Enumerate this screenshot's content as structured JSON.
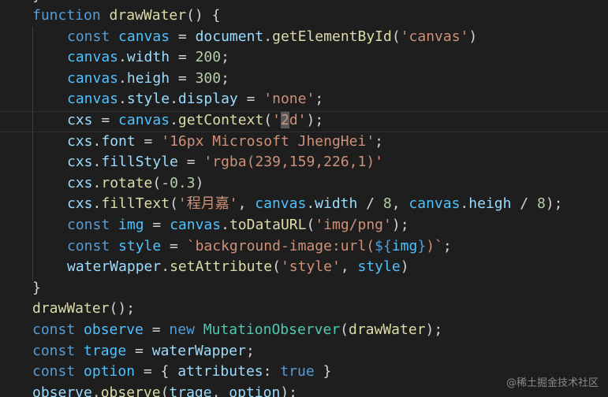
{
  "editor": {
    "colors": {
      "background": "#1e1e1e",
      "keyword": "#569cd6",
      "function": "#dcdcaa",
      "variable": "#9cdcfe",
      "constant": "#4fc1ff",
      "string": "#ce9178",
      "number": "#b5cea8",
      "class": "#4ec9b0"
    },
    "top_brace": "}",
    "lines": [
      {
        "indent": 0,
        "tokens": [
          [
            "kw",
            "function"
          ],
          [
            "pun",
            " "
          ],
          [
            "fn",
            "drawWater"
          ],
          [
            "pun",
            "() {"
          ]
        ]
      },
      {
        "indent": 1,
        "tokens": [
          [
            "kw",
            "const"
          ],
          [
            "pun",
            " "
          ],
          [
            "const",
            "canvas"
          ],
          [
            "pun",
            " = "
          ],
          [
            "var",
            "document"
          ],
          [
            "pun",
            "."
          ],
          [
            "fn",
            "getElementById"
          ],
          [
            "pun",
            "("
          ],
          [
            "str",
            "'canvas'"
          ],
          [
            "pun",
            ")"
          ]
        ]
      },
      {
        "indent": 1,
        "tokens": [
          [
            "const",
            "canvas"
          ],
          [
            "pun",
            "."
          ],
          [
            "var",
            "width"
          ],
          [
            "pun",
            " = "
          ],
          [
            "num",
            "200"
          ],
          [
            "pun",
            ";"
          ]
        ]
      },
      {
        "indent": 1,
        "tokens": [
          [
            "const",
            "canvas"
          ],
          [
            "pun",
            "."
          ],
          [
            "var",
            "heigh"
          ],
          [
            "pun",
            " = "
          ],
          [
            "num",
            "300"
          ],
          [
            "pun",
            ";"
          ]
        ]
      },
      {
        "indent": 1,
        "tokens": [
          [
            "const",
            "canvas"
          ],
          [
            "pun",
            "."
          ],
          [
            "var",
            "style"
          ],
          [
            "pun",
            "."
          ],
          [
            "var",
            "display"
          ],
          [
            "pun",
            " = "
          ],
          [
            "str",
            "'none'"
          ],
          [
            "pun",
            ";"
          ]
        ]
      },
      {
        "indent": 1,
        "tokens": [
          [
            "var",
            "cxs"
          ],
          [
            "pun",
            " = "
          ],
          [
            "const",
            "canvas"
          ],
          [
            "pun",
            "."
          ],
          [
            "fn",
            "getContext"
          ],
          [
            "pun",
            "("
          ],
          [
            "str",
            "'"
          ],
          [
            "cur",
            "2"
          ],
          [
            "str",
            "d'"
          ],
          [
            "pun",
            ");"
          ]
        ]
      },
      {
        "indent": 1,
        "tokens": [
          [
            "var",
            "cxs"
          ],
          [
            "pun",
            "."
          ],
          [
            "var",
            "font"
          ],
          [
            "pun",
            " = "
          ],
          [
            "str",
            "'16px Microsoft JhengHei'"
          ],
          [
            "pun",
            ";"
          ]
        ]
      },
      {
        "indent": 1,
        "tokens": [
          [
            "var",
            "cxs"
          ],
          [
            "pun",
            "."
          ],
          [
            "var",
            "fillStyle"
          ],
          [
            "pun",
            " = "
          ],
          [
            "str",
            "'rgba(239,159,226,1)'"
          ]
        ]
      },
      {
        "indent": 1,
        "tokens": [
          [
            "var",
            "cxs"
          ],
          [
            "pun",
            "."
          ],
          [
            "fn",
            "rotate"
          ],
          [
            "pun",
            "(-"
          ],
          [
            "num",
            "0.3"
          ],
          [
            "pun",
            ")"
          ]
        ]
      },
      {
        "indent": 1,
        "tokens": [
          [
            "var",
            "cxs"
          ],
          [
            "pun",
            "."
          ],
          [
            "fn",
            "fillText"
          ],
          [
            "pun",
            "("
          ],
          [
            "str",
            "'程月嘉'"
          ],
          [
            "pun",
            ", "
          ],
          [
            "const",
            "canvas"
          ],
          [
            "pun",
            "."
          ],
          [
            "var",
            "width"
          ],
          [
            "pun",
            " / "
          ],
          [
            "num",
            "8"
          ],
          [
            "pun",
            ", "
          ],
          [
            "const",
            "canvas"
          ],
          [
            "pun",
            "."
          ],
          [
            "var",
            "heigh"
          ],
          [
            "pun",
            " / "
          ],
          [
            "num",
            "8"
          ],
          [
            "pun",
            ");"
          ]
        ]
      },
      {
        "indent": 1,
        "tokens": [
          [
            "kw",
            "const"
          ],
          [
            "pun",
            " "
          ],
          [
            "const",
            "img"
          ],
          [
            "pun",
            " = "
          ],
          [
            "const",
            "canvas"
          ],
          [
            "pun",
            "."
          ],
          [
            "fn",
            "toDataURL"
          ],
          [
            "pun",
            "("
          ],
          [
            "str",
            "'img/png'"
          ],
          [
            "pun",
            ");"
          ]
        ]
      },
      {
        "indent": 1,
        "tokens": [
          [
            "kw",
            "const"
          ],
          [
            "pun",
            " "
          ],
          [
            "const",
            "style"
          ],
          [
            "pun",
            " = "
          ],
          [
            "str",
            "`background-image:url("
          ],
          [
            "tpl",
            "${"
          ],
          [
            "const",
            "img"
          ],
          [
            "tpl",
            "}"
          ],
          [
            "str",
            ")`"
          ],
          [
            "pun",
            ";"
          ]
        ]
      },
      {
        "indent": 1,
        "tokens": [
          [
            "var",
            "waterWapper"
          ],
          [
            "pun",
            "."
          ],
          [
            "fn",
            "setAttribute"
          ],
          [
            "pun",
            "("
          ],
          [
            "str",
            "'style'"
          ],
          [
            "pun",
            ", "
          ],
          [
            "const",
            "style"
          ],
          [
            "pun",
            ")"
          ]
        ]
      },
      {
        "indent": 0,
        "tokens": [
          [
            "pun",
            "}"
          ]
        ]
      },
      {
        "indent": 0,
        "tokens": [
          [
            "fn",
            "drawWater"
          ],
          [
            "pun",
            "();"
          ]
        ]
      },
      {
        "indent": 0,
        "tokens": [
          [
            "kw",
            "const"
          ],
          [
            "pun",
            " "
          ],
          [
            "const",
            "observe"
          ],
          [
            "pun",
            " = "
          ],
          [
            "kw",
            "new"
          ],
          [
            "pun",
            " "
          ],
          [
            "cls",
            "MutationObserver"
          ],
          [
            "pun",
            "("
          ],
          [
            "fn",
            "drawWater"
          ],
          [
            "pun",
            ");"
          ]
        ]
      },
      {
        "indent": 0,
        "tokens": [
          [
            "kw",
            "const"
          ],
          [
            "pun",
            " "
          ],
          [
            "const",
            "trage"
          ],
          [
            "pun",
            " = "
          ],
          [
            "var",
            "waterWapper"
          ],
          [
            "pun",
            ";"
          ]
        ]
      },
      {
        "indent": 0,
        "tokens": [
          [
            "kw",
            "const"
          ],
          [
            "pun",
            " "
          ],
          [
            "const",
            "option"
          ],
          [
            "pun",
            " = { "
          ],
          [
            "var",
            "attributes"
          ],
          [
            "pun",
            ": "
          ],
          [
            "kw",
            "true"
          ],
          [
            "pun",
            " }"
          ]
        ]
      },
      {
        "indent": 0,
        "tokens": [
          [
            "var",
            "observe"
          ],
          [
            "pun",
            "."
          ],
          [
            "fn",
            "observe"
          ],
          [
            "pun",
            "("
          ],
          [
            "var",
            "trage"
          ],
          [
            "pun",
            ", "
          ],
          [
            "var",
            "option"
          ],
          [
            "pun",
            ");"
          ]
        ]
      }
    ]
  },
  "watermark": "@稀土掘金技术社区"
}
